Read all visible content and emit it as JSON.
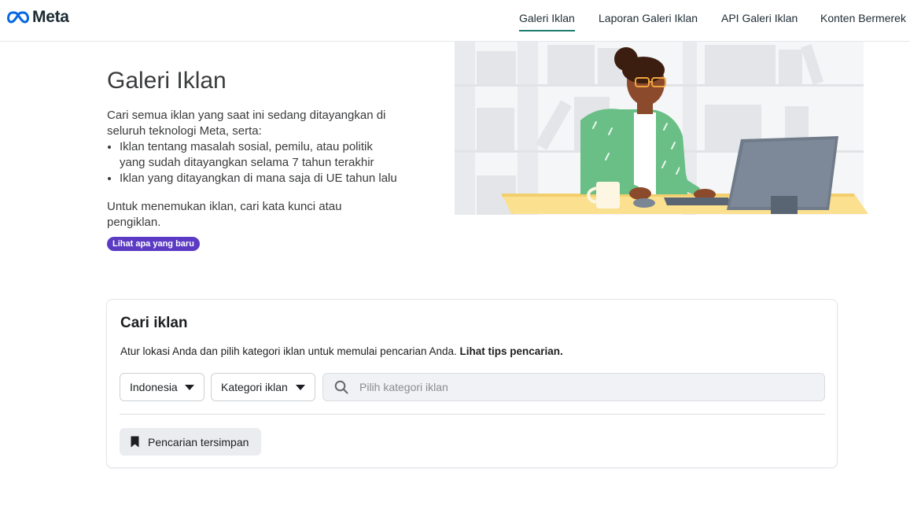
{
  "brand": {
    "name": "Meta"
  },
  "nav": {
    "items": [
      {
        "label": "Galeri Iklan",
        "active": true
      },
      {
        "label": "Laporan Galeri Iklan",
        "active": false
      },
      {
        "label": "API Galeri Iklan",
        "active": false
      },
      {
        "label": "Konten Bermerek",
        "active": false
      }
    ]
  },
  "intro": {
    "title": "Galeri Iklan",
    "lead": "Cari semua iklan yang saat ini sedang ditayangkan di seluruh teknologi Meta, serta:",
    "bullets": [
      "Iklan tentang masalah sosial, pemilu, atau politik yang sudah ditayangkan selama 7 tahun terakhir",
      "Iklan yang ditayangkan di mana saja di UE tahun lalu"
    ],
    "instruction": "Untuk menemukan iklan, cari kata kunci atau pengiklan.",
    "whats_new": "Lihat apa yang baru"
  },
  "search": {
    "title": "Cari iklan",
    "description": "Atur lokasi Anda dan pilih kategori iklan untuk memulai pencarian Anda.",
    "tips_link": "Lihat tips pencarian.",
    "country": "Indonesia",
    "category": "Kategori iklan",
    "input_value": "",
    "placeholder": "Pilih kategori iklan",
    "saved_searches": "Pencarian tersimpan"
  },
  "icons": {
    "logo": "meta-infinity-icon",
    "search": "search-icon",
    "bookmark": "bookmark-icon",
    "caret": "caret-down-icon"
  },
  "colors": {
    "accent_underline": "#1d7c6f",
    "pill": "#5b3ac4",
    "logo_blue": "#0668e1"
  }
}
